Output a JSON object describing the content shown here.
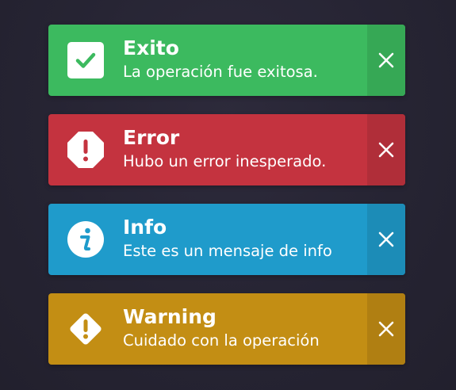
{
  "toasts": [
    {
      "type": "success",
      "title": "Exito",
      "message": "La operación fue exitosa.",
      "icon": "check-icon",
      "close_icon": "close-icon",
      "color": "#3cba5f",
      "close_bg": "#36a855"
    },
    {
      "type": "error",
      "title": "Error",
      "message": "Hubo un error inesperado.",
      "icon": "alert-octagon-icon",
      "close_icon": "close-icon",
      "color": "#c4333f",
      "close_bg": "#b02e39"
    },
    {
      "type": "info",
      "title": "Info",
      "message": "Este es un mensaje de info",
      "icon": "info-circle-icon",
      "close_icon": "close-icon",
      "color": "#1f9bcb",
      "close_bg": "#1c8cb7"
    },
    {
      "type": "warning",
      "title": "Warning",
      "message": "Cuidado con la operación",
      "icon": "warning-diamond-icon",
      "close_icon": "close-icon",
      "color": "#c38e14",
      "close_bg": "#b07f12"
    }
  ]
}
